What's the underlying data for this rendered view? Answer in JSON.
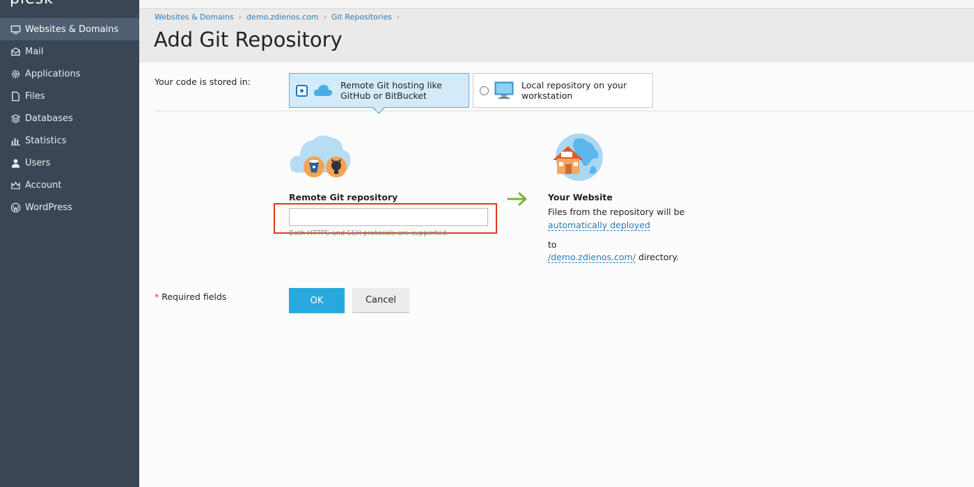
{
  "app": {
    "logo_text": "plesk"
  },
  "sidebar": {
    "items": [
      {
        "label": "Websites & Domains",
        "icon": "monitor-icon",
        "active": true
      },
      {
        "label": "Mail",
        "icon": "mail-icon",
        "active": false
      },
      {
        "label": "Applications",
        "icon": "gear-icon",
        "active": false
      },
      {
        "label": "Files",
        "icon": "file-icon",
        "active": false
      },
      {
        "label": "Databases",
        "icon": "database-icon",
        "active": false
      },
      {
        "label": "Statistics",
        "icon": "bar-chart-icon",
        "active": false
      },
      {
        "label": "Users",
        "icon": "user-icon",
        "active": false
      },
      {
        "label": "Account",
        "icon": "account-icon",
        "active": false
      },
      {
        "label": "WordPress",
        "icon": "wordpress-icon",
        "active": false
      }
    ]
  },
  "breadcrumb": {
    "items": [
      "Websites & Domains",
      "demo.zdienos.com",
      "Git Repositories"
    ]
  },
  "page": {
    "title": "Add Git Repository"
  },
  "form": {
    "stored_label": "Your code is stored in:",
    "option_remote": "Remote Git hosting like GitHub or BitBucket",
    "option_local": "Local repository on your workstation",
    "remote_label": "Remote Git repository",
    "remote_value": "",
    "remote_hint": "Both HTTPS and SSH protocols are supported.",
    "website_title": "Your Website",
    "website_desc": "Files from the repository will be",
    "deploy_link": "automatically deployed",
    "to_text": "to",
    "dir_link": "/demo.zdienos.com/",
    "dir_suffix": " directory.",
    "required_star": "*",
    "required_text": " Required fields",
    "ok_label": "OK",
    "cancel_label": "Cancel"
  },
  "colors": {
    "sidebar_bg": "#3a4655",
    "accent": "#28a8dd",
    "link": "#2e7bb5",
    "highlight_border": "#e0391c",
    "selected_option_bg": "#d3ebf9",
    "arrow": "#7ab32e"
  }
}
